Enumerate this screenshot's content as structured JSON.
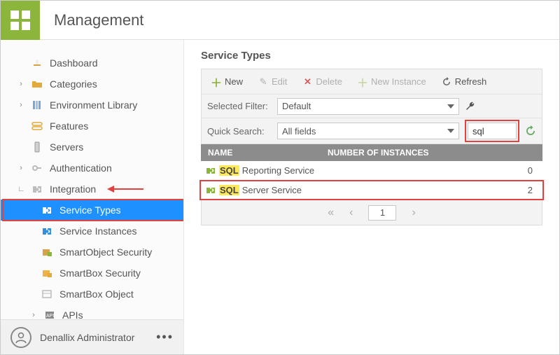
{
  "header": {
    "title": "Management"
  },
  "sidebar": {
    "items": [
      {
        "label": "Dashboard"
      },
      {
        "label": "Categories"
      },
      {
        "label": "Environment Library"
      },
      {
        "label": "Features"
      },
      {
        "label": "Servers"
      },
      {
        "label": "Authentication"
      },
      {
        "label": "Integration"
      },
      {
        "label": "Service Types"
      },
      {
        "label": "Service Instances"
      },
      {
        "label": "SmartObject Security"
      },
      {
        "label": "SmartBox Security"
      },
      {
        "label": "SmartBox Object"
      },
      {
        "label": "APIs"
      }
    ]
  },
  "user": {
    "name": "Denallix Administrator"
  },
  "content": {
    "title": "Service Types",
    "toolbar": {
      "new": "New",
      "edit": "Edit",
      "delete": "Delete",
      "newInstance": "New Instance",
      "refresh": "Refresh"
    },
    "filter": {
      "label": "Selected Filter:",
      "value": "Default"
    },
    "quickSearch": {
      "label": "Quick Search:",
      "fieldValue": "All fields",
      "query": "sql"
    },
    "columns": {
      "c1": "NAME",
      "c2": "NUMBER OF INSTANCES"
    },
    "rows": [
      {
        "hl": "SQL",
        "rest": " Reporting Service",
        "count": "0"
      },
      {
        "hl": "SQL",
        "rest": " Server Service",
        "count": "2"
      }
    ],
    "pager": {
      "page": "1"
    }
  }
}
